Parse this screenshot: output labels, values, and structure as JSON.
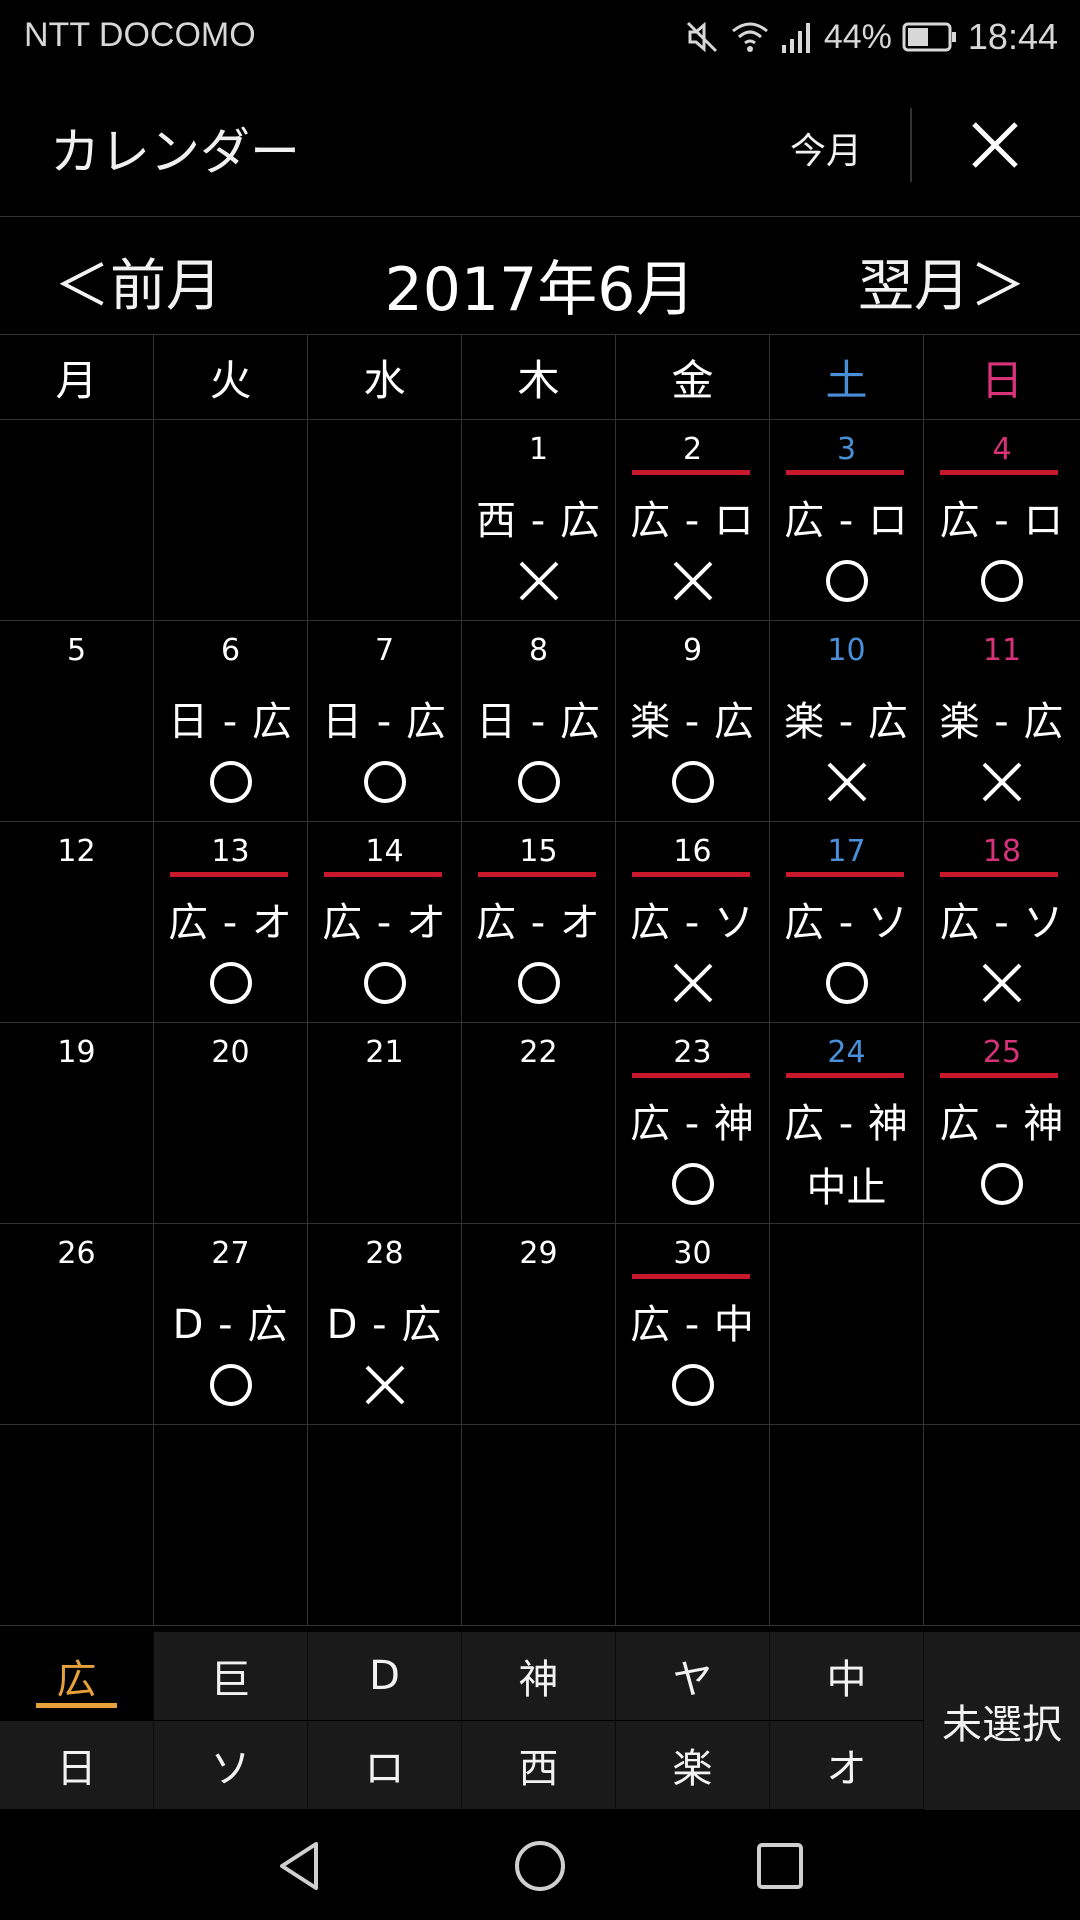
{
  "status_bar": {
    "carrier": "NTT DOCOMO",
    "battery": "44%",
    "time": "18:44",
    "icons": [
      "mute-icon",
      "wifi-icon",
      "signal-icon",
      "battery-icon"
    ]
  },
  "header": {
    "title": "カレンダー",
    "this_month": "今月",
    "close_icon": "close-icon"
  },
  "month_nav": {
    "prev": "＜前月",
    "title": "2017年6月",
    "next": "翌月＞"
  },
  "weekdays": [
    "月",
    "火",
    "水",
    "木",
    "金",
    "土",
    "日"
  ],
  "colors": {
    "saturday": "#4a90d9",
    "sunday": "#d8327a",
    "home_underline": "#c7192b",
    "active_team": "#e7a13b",
    "grid_line": "#333333",
    "team_bg": "#1a1a1a"
  },
  "calendar": {
    "weeks": [
      [
        {
          "day": ""
        },
        {
          "day": ""
        },
        {
          "day": ""
        },
        {
          "day": "1",
          "match": "西 - 広",
          "result": "×"
        },
        {
          "day": "2",
          "match": "広 - ロ",
          "result": "×",
          "home": true
        },
        {
          "day": "3",
          "match": "広 - ロ",
          "result": "○",
          "home": true
        },
        {
          "day": "4",
          "match": "広 - ロ",
          "result": "○",
          "home": true
        }
      ],
      [
        {
          "day": "5"
        },
        {
          "day": "6",
          "match": "日 - 広",
          "result": "○"
        },
        {
          "day": "7",
          "match": "日 - 広",
          "result": "○"
        },
        {
          "day": "8",
          "match": "日 - 広",
          "result": "○"
        },
        {
          "day": "9",
          "match": "楽 - 広",
          "result": "○"
        },
        {
          "day": "10",
          "match": "楽 - 広",
          "result": "×"
        },
        {
          "day": "11",
          "match": "楽 - 広",
          "result": "×"
        }
      ],
      [
        {
          "day": "12"
        },
        {
          "day": "13",
          "match": "広 - オ",
          "result": "○",
          "home": true
        },
        {
          "day": "14",
          "match": "広 - オ",
          "result": "○",
          "home": true
        },
        {
          "day": "15",
          "match": "広 - オ",
          "result": "○",
          "home": true
        },
        {
          "day": "16",
          "match": "広 - ソ",
          "result": "×",
          "home": true
        },
        {
          "day": "17",
          "match": "広 - ソ",
          "result": "○",
          "home": true
        },
        {
          "day": "18",
          "match": "広 - ソ",
          "result": "×",
          "home": true
        }
      ],
      [
        {
          "day": "19"
        },
        {
          "day": "20"
        },
        {
          "day": "21"
        },
        {
          "day": "22"
        },
        {
          "day": "23",
          "match": "広 - 神",
          "result": "○",
          "home": true
        },
        {
          "day": "24",
          "match": "広 - 神",
          "result": "中止",
          "home": true
        },
        {
          "day": "25",
          "match": "広 - 神",
          "result": "○",
          "home": true
        }
      ],
      [
        {
          "day": "26"
        },
        {
          "day": "27",
          "match": "D - 広",
          "result": "○"
        },
        {
          "day": "28",
          "match": "D - 広",
          "result": "×"
        },
        {
          "day": "29"
        },
        {
          "day": "30",
          "match": "広 - 中",
          "result": "○",
          "home": true
        },
        {
          "day": ""
        },
        {
          "day": ""
        }
      ],
      [
        {
          "day": ""
        },
        {
          "day": ""
        },
        {
          "day": ""
        },
        {
          "day": ""
        },
        {
          "day": ""
        },
        {
          "day": ""
        },
        {
          "day": ""
        }
      ]
    ]
  },
  "team_selector": {
    "row1": [
      "広",
      "巨",
      "D",
      "神",
      "ヤ",
      "中"
    ],
    "row2": [
      "日",
      "ソ",
      "ロ",
      "西",
      "楽",
      "オ"
    ],
    "active": "広",
    "unselected_label": "未選択"
  },
  "nav_bar": {
    "icons": [
      "back-icon",
      "home-icon",
      "recents-icon"
    ]
  }
}
